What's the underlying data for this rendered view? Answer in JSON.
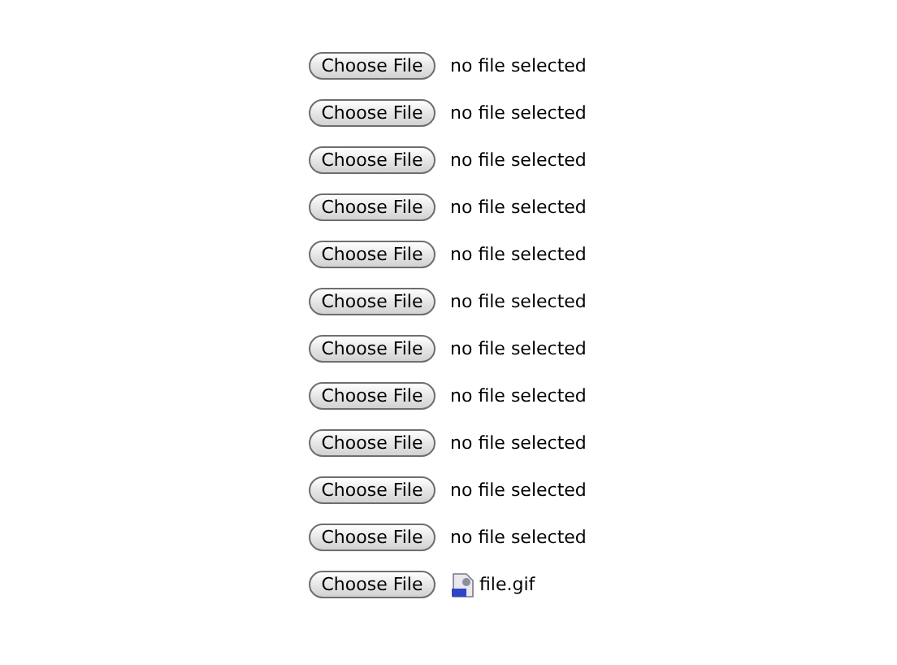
{
  "file_inputs": [
    {
      "kind": "empty",
      "button": "Choose File",
      "status": "no file selected"
    },
    {
      "kind": "empty",
      "button": "Choose File",
      "status": "no file selected"
    },
    {
      "kind": "empty",
      "button": "Choose File",
      "status": "no file selected"
    },
    {
      "kind": "empty",
      "button": "Choose File",
      "status": "no file selected"
    },
    {
      "kind": "empty",
      "button": "Choose File",
      "status": "no file selected"
    },
    {
      "kind": "empty",
      "button": "Choose File",
      "status": "no file selected"
    },
    {
      "kind": "empty",
      "button": "Choose File",
      "status": "no file selected"
    },
    {
      "kind": "empty",
      "button": "Choose File",
      "status": "no file selected"
    },
    {
      "kind": "empty",
      "button": "Choose File",
      "status": "no file selected"
    },
    {
      "kind": "empty",
      "button": "Choose File",
      "status": "no file selected"
    },
    {
      "kind": "empty",
      "button": "Choose File",
      "status": "no file selected"
    },
    {
      "kind": "file",
      "button": "Choose File",
      "status": "file.gif"
    }
  ]
}
